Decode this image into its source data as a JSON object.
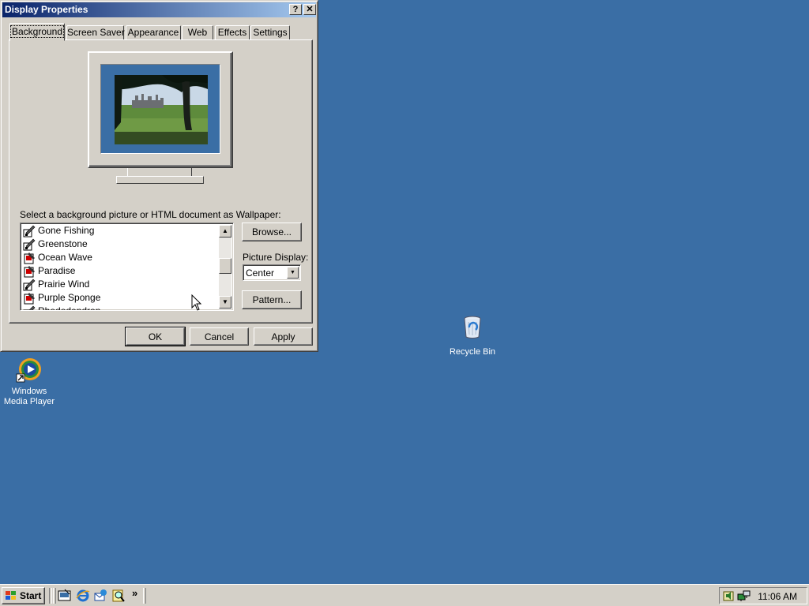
{
  "window": {
    "title": "Display Properties",
    "help_button": "?",
    "close_button": "✕"
  },
  "tabs": [
    {
      "label": "Background",
      "active": true
    },
    {
      "label": "Screen Saver",
      "active": false
    },
    {
      "label": "Appearance",
      "active": false
    },
    {
      "label": "Web",
      "active": false
    },
    {
      "label": "Effects",
      "active": false
    },
    {
      "label": "Settings",
      "active": false
    }
  ],
  "background_tab": {
    "wallpaper_label": "Select a background picture or HTML document as Wallpaper:",
    "wallpapers": [
      {
        "name": "Gone Fishing",
        "icon": "paint-brush-icon"
      },
      {
        "name": "Greenstone",
        "icon": "paint-brush-icon"
      },
      {
        "name": "Ocean Wave",
        "icon": "bitmap-file-icon"
      },
      {
        "name": "Paradise",
        "icon": "bitmap-file-icon"
      },
      {
        "name": "Prairie Wind",
        "icon": "paint-brush-icon"
      },
      {
        "name": "Purple Sponge",
        "icon": "bitmap-file-icon"
      },
      {
        "name": "Rhododendron",
        "icon": "paint-brush-icon"
      }
    ],
    "browse_button": "Browse...",
    "picture_display_label": "Picture Display:",
    "picture_display_value": "Center",
    "pattern_button": "Pattern..."
  },
  "dialog_buttons": {
    "ok": "OK",
    "cancel": "Cancel",
    "apply": "Apply"
  },
  "desktop_icons": {
    "recycle_bin": "Recycle Bin",
    "media_player_line1": "Windows",
    "media_player_line2": "Media Player"
  },
  "taskbar": {
    "start": "Start",
    "more_chevron": "»",
    "clock": "11:06 AM"
  },
  "colors": {
    "desktop": "#3a6ea5",
    "title_gradient_start": "#0a246a",
    "title_gradient_end": "#a6caf0",
    "face": "#d4d0c8"
  }
}
